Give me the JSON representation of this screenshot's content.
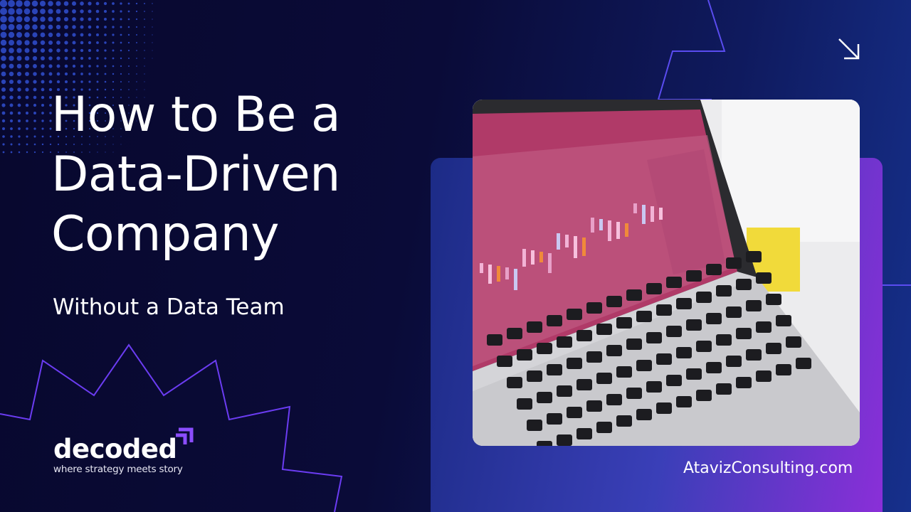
{
  "title": {
    "lines": [
      "How to Be a",
      "Data-Driven",
      "Company"
    ]
  },
  "subtitle": "Without a Data Team",
  "brand": {
    "name": "decoded",
    "tagline": "where strategy meets story",
    "mark_color": "#8b4dff"
  },
  "website": "AtavizConsulting.com",
  "icons": {
    "corner": "arrow-down-right-icon"
  },
  "colors": {
    "background": "#0a0b38",
    "accent_purple": "#8a2fd8",
    "accent_blue": "#3a3fb8",
    "dots": "#2a44b8",
    "zigzag": "#6a3cff"
  },
  "photo": {
    "subject": "laptop-trading-dashboard"
  }
}
